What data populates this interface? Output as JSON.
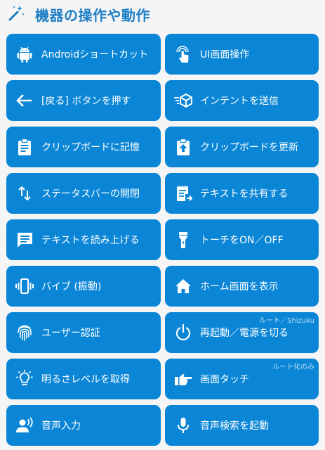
{
  "header": {
    "title": "機器の操作や動作",
    "icon": "magic-wand-icon",
    "title_color": "#1f7fc4"
  },
  "theme": {
    "button_color": "#0b86d6",
    "text_color": "#ffffff"
  },
  "buttons": [
    {
      "label": "Androidショートカット",
      "icon": "android-icon"
    },
    {
      "label": "UI画面操作",
      "icon": "touch-icon"
    },
    {
      "label": "[戻る] ボタンを押す",
      "icon": "arrow-left-icon"
    },
    {
      "label": "インテントを送信",
      "icon": "send-cube-icon"
    },
    {
      "label": "クリップボードに記憶",
      "icon": "clipboard-list-icon"
    },
    {
      "label": "クリップボードを更新",
      "icon": "clipboard-up-icon"
    },
    {
      "label": "ステータスバーの開閉",
      "icon": "swap-vertical-icon"
    },
    {
      "label": "テキストを共有する",
      "icon": "receipt-share-icon"
    },
    {
      "label": "テキストを読み上げる",
      "icon": "message-icon"
    },
    {
      "label": "トーチをON／OFF",
      "icon": "flashlight-icon"
    },
    {
      "label": "バイブ (振動)",
      "icon": "vibrate-icon"
    },
    {
      "label": "ホーム画面を表示",
      "icon": "home-icon"
    },
    {
      "label": "ユーザー認証",
      "icon": "fingerprint-icon"
    },
    {
      "label": "再起動／電源を切る",
      "icon": "power-icon",
      "note": "ルート／Shizuku"
    },
    {
      "label": "明るさレベルを取得",
      "icon": "lightbulb-icon"
    },
    {
      "label": "画面タッチ",
      "icon": "pointing-hand-icon",
      "note": "ルート化のみ"
    },
    {
      "label": "音声入力",
      "icon": "voice-person-icon"
    },
    {
      "label": "音声検索を起動",
      "icon": "microphone-icon"
    }
  ]
}
